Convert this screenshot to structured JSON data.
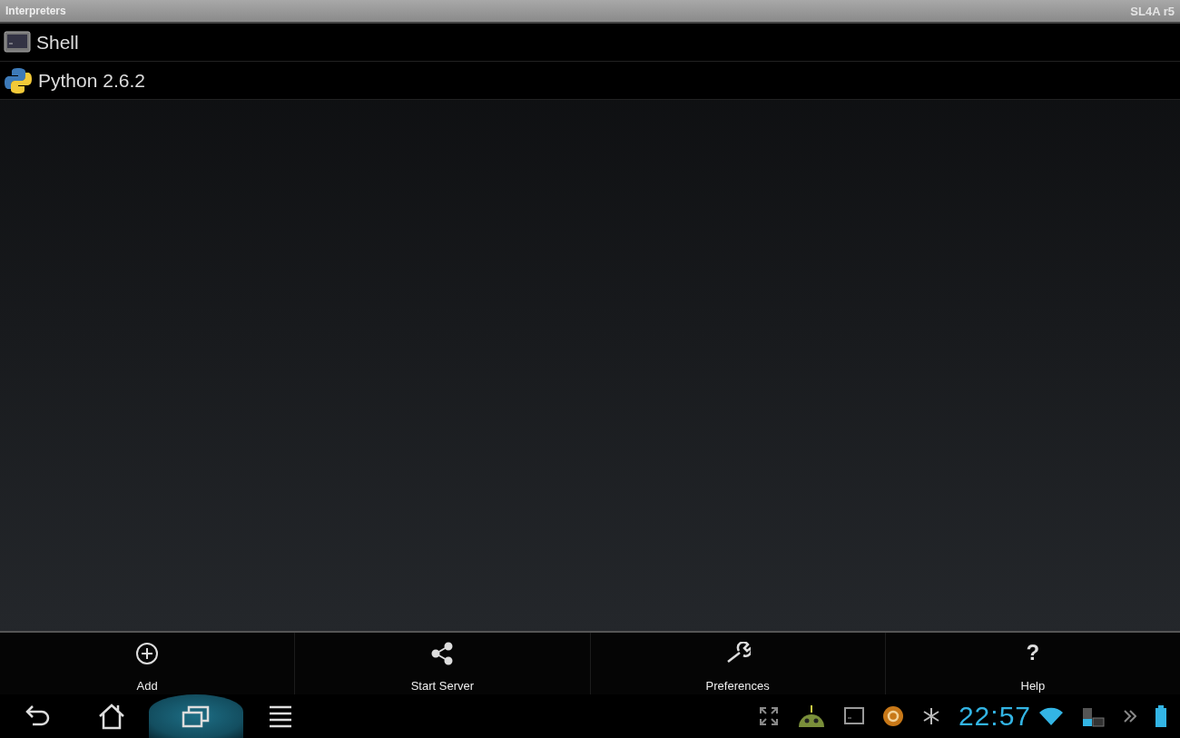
{
  "title_bar": {
    "title": "Interpreters",
    "version": "SL4A r5"
  },
  "interpreters": [
    {
      "kind": "shell",
      "name": "Shell"
    },
    {
      "kind": "python",
      "name": "Python 2.6.2"
    }
  ],
  "menu": [
    {
      "kind": "add",
      "label": "Add"
    },
    {
      "kind": "share",
      "label": "Start Server"
    },
    {
      "kind": "wrench",
      "label": "Preferences"
    },
    {
      "kind": "glyph",
      "glyph": "?",
      "label": "Help"
    }
  ],
  "nav": [
    {
      "kind": "back",
      "selected": false
    },
    {
      "kind": "home",
      "selected": false
    },
    {
      "kind": "recent",
      "selected": true
    },
    {
      "kind": "menu",
      "selected": false
    }
  ],
  "status": {
    "time": "22:57"
  }
}
